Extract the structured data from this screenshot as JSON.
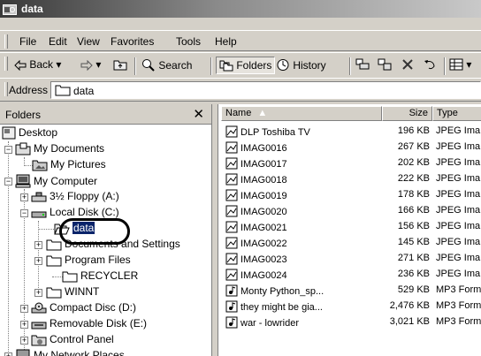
{
  "window": {
    "title": "data"
  },
  "menu": [
    "File",
    "Edit",
    "View",
    "Favorites",
    "Tools",
    "Help"
  ],
  "toolbar": {
    "back": "Back",
    "search": "Search",
    "folders": "Folders",
    "history": "History"
  },
  "address": {
    "label": "Address",
    "value": "data"
  },
  "folders_pane": {
    "title": "Folders",
    "close": "✕",
    "tree": [
      "Desktop",
      "My Documents",
      "My Pictures",
      "My Computer",
      "3½ Floppy (A:)",
      "Local Disk (C:)",
      "data",
      "Documents and Settings",
      "Program Files",
      "RECYCLER",
      "WINNT",
      "Compact Disc (D:)",
      "Removable Disk (E:)",
      "Control Panel",
      "My Network Places"
    ]
  },
  "files": {
    "columns": {
      "name": "Name",
      "size": "Size",
      "type": "Type"
    },
    "rows": [
      {
        "name": "DLP Toshiba TV",
        "size": "196 KB",
        "type": "JPEG Ima"
      },
      {
        "name": "IMAG0016",
        "size": "267 KB",
        "type": "JPEG Ima"
      },
      {
        "name": "IMAG0017",
        "size": "202 KB",
        "type": "JPEG Ima"
      },
      {
        "name": "IMAG0018",
        "size": "222 KB",
        "type": "JPEG Ima"
      },
      {
        "name": "IMAG0019",
        "size": "178 KB",
        "type": "JPEG Ima"
      },
      {
        "name": "IMAG0020",
        "size": "166 KB",
        "type": "JPEG Ima"
      },
      {
        "name": "IMAG0021",
        "size": "156 KB",
        "type": "JPEG Ima"
      },
      {
        "name": "IMAG0022",
        "size": "145 KB",
        "type": "JPEG Ima"
      },
      {
        "name": "IMAG0023",
        "size": "271 KB",
        "type": "JPEG Ima"
      },
      {
        "name": "IMAG0024",
        "size": "236 KB",
        "type": "JPEG Ima"
      },
      {
        "name": "Monty Python_sp...",
        "size": "529 KB",
        "type": "MP3 Form"
      },
      {
        "name": "they might be gia...",
        "size": "2,476 KB",
        "type": "MP3 Form"
      },
      {
        "name": "war - lowrider",
        "size": "3,021 KB",
        "type": "MP3 Form"
      }
    ]
  }
}
